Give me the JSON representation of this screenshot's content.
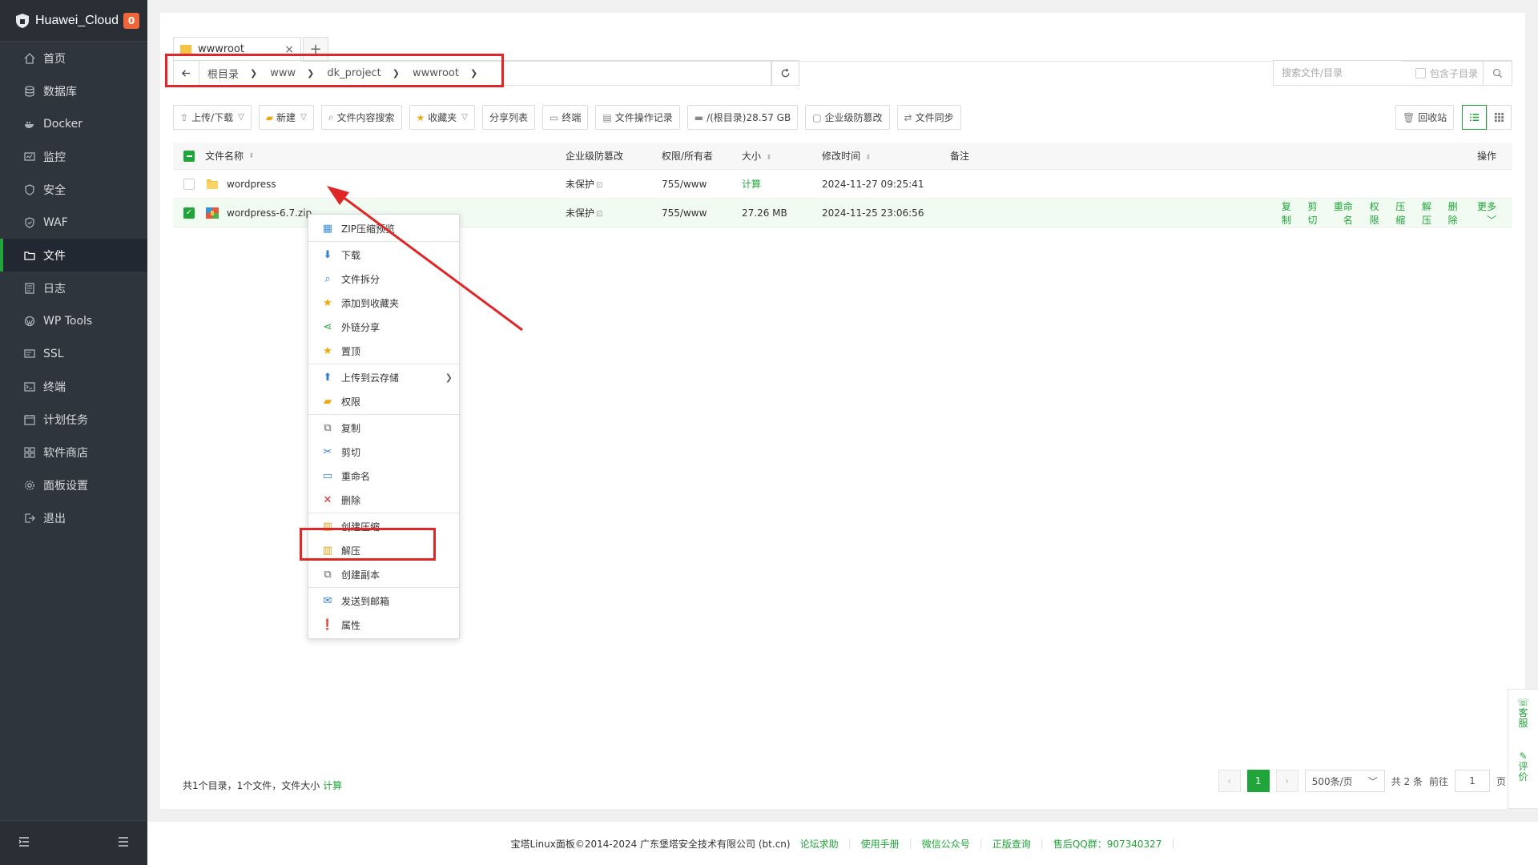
{
  "sidebar": {
    "brand": "Huawei_Cloud",
    "badge": "0",
    "items": [
      {
        "label": "首页"
      },
      {
        "label": "数据库"
      },
      {
        "label": "Docker"
      },
      {
        "label": "监控"
      },
      {
        "label": "安全"
      },
      {
        "label": "WAF"
      },
      {
        "label": "文件"
      },
      {
        "label": "日志"
      },
      {
        "label": "WP Tools"
      },
      {
        "label": "SSL"
      },
      {
        "label": "终端"
      },
      {
        "label": "计划任务"
      },
      {
        "label": "软件商店"
      },
      {
        "label": "面板设置"
      },
      {
        "label": "退出"
      }
    ]
  },
  "tabs": [
    {
      "label": "wwwroot"
    }
  ],
  "path": [
    "根目录",
    "www",
    "dk_project",
    "wwwroot"
  ],
  "search": {
    "placeholder": "搜索文件/目录",
    "subdir_label": "包含子目录"
  },
  "toolbar": {
    "upload": "上传/下载",
    "new": "新建",
    "content_search": "文件内容搜索",
    "favorites": "收藏夹",
    "share_list": "分享列表",
    "terminal": "终端",
    "op_log": "文件操作记录",
    "disk": "/(根目录)28.57 GB",
    "tamper": "企业级防篡改",
    "sync": "文件同步",
    "recycle": "回收站"
  },
  "table": {
    "headers": {
      "name": "文件名称",
      "protect": "企业级防篡改",
      "perm": "权限/所有者",
      "size": "大小",
      "mtime": "修改时间",
      "note": "备注",
      "ops": "操作"
    },
    "rows": [
      {
        "name": "wordpress",
        "protect": "未保护",
        "perm": "755/www",
        "size": "计算",
        "mtime": "2024-11-27 09:25:41",
        "note": ""
      },
      {
        "name": "wordpress-6.7.zip",
        "protect": "未保护",
        "perm": "755/www",
        "size": "27.26 MB",
        "mtime": "2024-11-25 23:06:56",
        "note": ""
      }
    ],
    "row_ops": [
      "复制",
      "剪切",
      "重命名",
      "权限",
      "压缩",
      "解压",
      "删除",
      "更多"
    ]
  },
  "context_menu": {
    "items": [
      {
        "label": "ZIP压缩预览",
        "icon": "zip-icon"
      },
      {
        "label": "下载",
        "icon": "download-icon"
      },
      {
        "label": "文件拆分",
        "icon": "split-icon"
      },
      {
        "label": "添加到收藏夹",
        "icon": "star-icon"
      },
      {
        "label": "外链分享",
        "icon": "share-icon"
      },
      {
        "label": "置顶",
        "icon": "pin-icon"
      },
      {
        "label": "上传到云存储",
        "icon": "cloud-upload-icon"
      },
      {
        "label": "权限",
        "icon": "permission-icon"
      },
      {
        "label": "复制",
        "icon": "copy-icon"
      },
      {
        "label": "剪切",
        "icon": "cut-icon"
      },
      {
        "label": "重命名",
        "icon": "rename-icon"
      },
      {
        "label": "删除",
        "icon": "delete-icon"
      },
      {
        "label": "创建压缩",
        "icon": "compress-icon"
      },
      {
        "label": "解压",
        "icon": "extract-icon"
      },
      {
        "label": "创建副本",
        "icon": "duplicate-icon"
      },
      {
        "label": "发送到邮箱",
        "icon": "mail-icon"
      },
      {
        "label": "属性",
        "icon": "info-icon"
      }
    ]
  },
  "summary": {
    "text": "共1个目录，1个文件，文件大小",
    "calc": "计算"
  },
  "pager": {
    "current": "1",
    "page_size": "500条/页",
    "total": "共 2 条",
    "goto": "前往",
    "input": "1",
    "unit": "页"
  },
  "footer": {
    "copyright": "宝塔Linux面板©2014-2024 广东堡塔安全技术有限公司 (bt.cn)",
    "links": [
      "论坛求助",
      "使用手册",
      "微信公众号",
      "正版查询",
      "售后QQ群：907340327"
    ]
  },
  "float": {
    "service": "客服",
    "review": "评价"
  },
  "colors": {
    "accent": "#20a53a",
    "annotation": "#e02727",
    "sidebar": "#2f353d"
  }
}
